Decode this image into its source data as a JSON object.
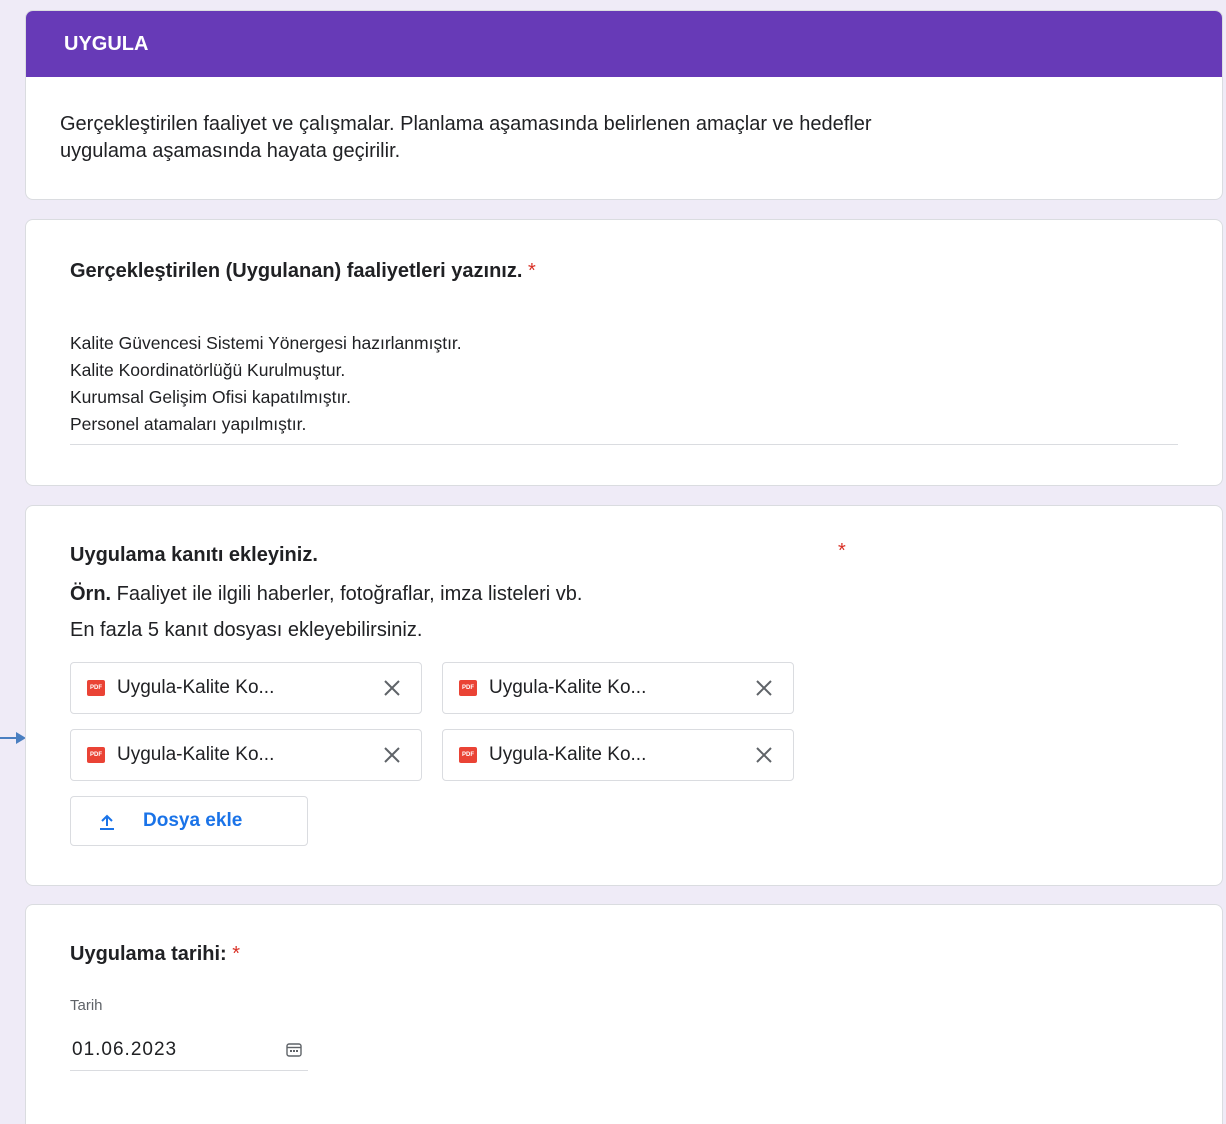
{
  "section": {
    "title": "UYGULA",
    "description_line1": "Gerçekleştirilen faaliyet ve çalışmalar. Planlama aşamasında belirlenen amaçlar ve hedefler",
    "description_line2": "uygulama aşamasında hayata geçirilir."
  },
  "q_activities": {
    "title": "Gerçekleştirilen (Uygulanan) faaliyetleri yazınız.",
    "required_mark": "*",
    "answer_lines": [
      "Kalite Güvencesi Sistemi Yönergesi hazırlanmıştır.",
      "Kalite Koordinatörlüğü Kurulmuştur.",
      "Kurumsal Gelişim Ofisi kapatılmıştır.",
      "Personel atamaları yapılmıştır."
    ]
  },
  "q_evidence": {
    "title": "Uygulama kanıtı ekleyiniz.",
    "required_mark": "*",
    "example_prefix": "Örn.",
    "example_text": " Faaliyet ile ilgili haberler, fotoğraflar, imza listeleri vb.",
    "limit_text": "En fazla 5 kanıt dosyası ekleyebilirsiniz.",
    "files": [
      {
        "name": "Uygula-Kalite Ko...",
        "icon": "pdf-icon",
        "icon_text": "PDF"
      },
      {
        "name": "Uygula-Kalite Ko...",
        "icon": "pdf-icon",
        "icon_text": "PDF"
      },
      {
        "name": "Uygula-Kalite Ko...",
        "icon": "pdf-icon",
        "icon_text": "PDF"
      },
      {
        "name": "Uygula-Kalite Ko...",
        "icon": "pdf-icon",
        "icon_text": "PDF"
      }
    ],
    "add_button_label": "Dosya ekle"
  },
  "q_date": {
    "title": "Uygulama tarihi:",
    "required_mark": "*",
    "field_label": "Tarih",
    "value": "01.06.2023"
  },
  "colors": {
    "accent": "#673ab7",
    "required": "#d93025",
    "link": "#1a73e8",
    "pdf": "#ea4335",
    "background": "#efebf7"
  }
}
